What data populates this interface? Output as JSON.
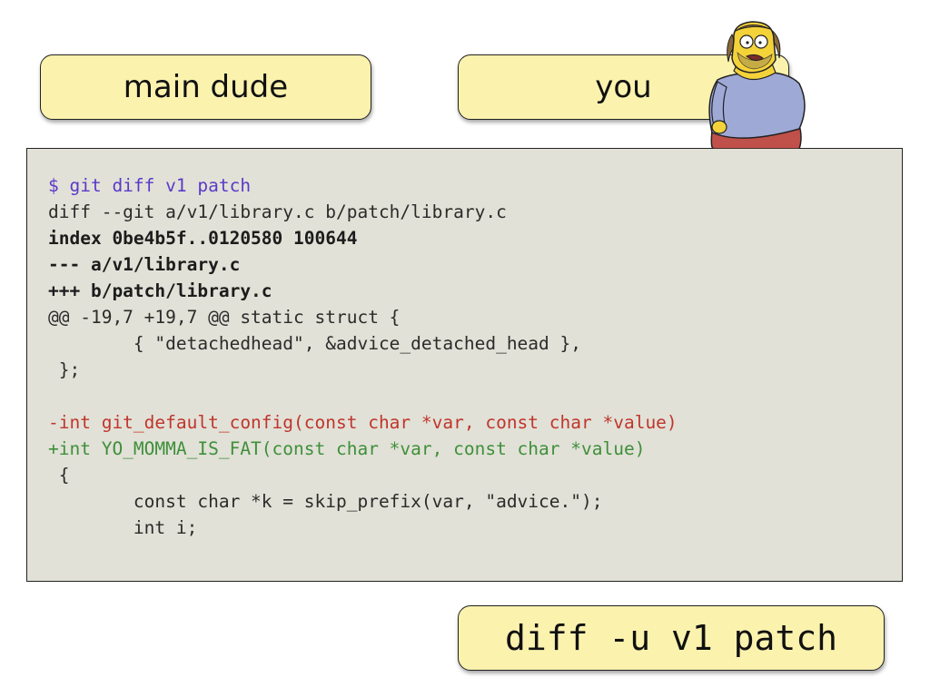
{
  "labels": {
    "left": "main dude",
    "right": "you",
    "command": "diff -u v1 patch"
  },
  "code": {
    "lines": [
      {
        "text": "$ git diff v1 patch",
        "kind": "prompt"
      },
      {
        "text": "diff --git a/v1/library.c b/patch/library.c",
        "kind": "normal"
      },
      {
        "text": "index 0be4b5f..0120580 100644",
        "kind": "bold"
      },
      {
        "text": "--- a/v1/library.c",
        "kind": "bold"
      },
      {
        "text": "+++ b/patch/library.c",
        "kind": "bold"
      },
      {
        "text": "@@ -19,7 +19,7 @@ static struct {",
        "kind": "normal"
      },
      {
        "text": "        { \"detachedhead\", &advice_detached_head },",
        "kind": "normal"
      },
      {
        "text": " };",
        "kind": "normal"
      },
      {
        "text": "",
        "kind": "normal"
      },
      {
        "text": "-int git_default_config(const char *var, const char *value)",
        "kind": "del"
      },
      {
        "text": "+int YO_MOMMA_IS_FAT(const char *var, const char *value)",
        "kind": "add"
      },
      {
        "text": " {",
        "kind": "normal"
      },
      {
        "text": "        const char *k = skip_prefix(var, \"advice.\");",
        "kind": "normal"
      },
      {
        "text": "        int i;",
        "kind": "normal"
      }
    ]
  },
  "colors": {
    "label_fill": "#fbf2ae",
    "panel_fill": "#e1e1d7",
    "prompt": "#5b39c9",
    "deleted": "#c0352c",
    "added": "#3f8f3a"
  },
  "icons": {
    "character": "comic-book-guy-illustration"
  }
}
